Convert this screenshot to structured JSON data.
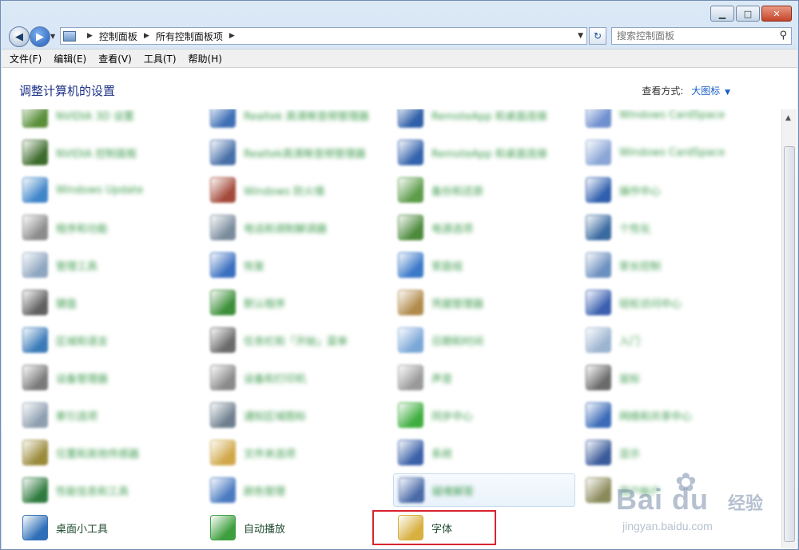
{
  "window": {
    "address_path": [
      "控制面板",
      "所有控制面板项"
    ],
    "search_placeholder": "搜索控制面板",
    "caption_buttons": {
      "minimize": "▁",
      "maximize": "□",
      "close": "✕"
    }
  },
  "menu": [
    "文件(F)",
    "编辑(E)",
    "查看(V)",
    "工具(T)",
    "帮助(H)"
  ],
  "page": {
    "title": "调整计算机的设置",
    "view_by_label": "查看方式:",
    "view_by_value": "大图标"
  },
  "items": [
    {
      "label": "NVIDIA 3D 设置",
      "color": "#5a8f3a",
      "blurred": true
    },
    {
      "label": "Realtek 高清晰音频管理器",
      "color": "#3f6fb5",
      "blurred": true
    },
    {
      "label": "RemoteApp 和桌面连接",
      "color": "#2e5fa8",
      "blurred": true
    },
    {
      "label": "Windows CardSpace",
      "color": "#6f8fcf",
      "blurred": true
    },
    {
      "label": "NVIDIA 控制面板",
      "color": "#3d6b2b",
      "blurred": true
    },
    {
      "label": "Realtek高清晰音频管理器",
      "color": "#476fa8",
      "blurred": true
    },
    {
      "label": "RemoteApp 和桌面连接",
      "color": "#3262ac",
      "blurred": true
    },
    {
      "label": "Windows CardSpace",
      "color": "#8aa5d6",
      "blurred": true
    },
    {
      "label": "Windows Update",
      "color": "#3f85c9",
      "blurred": true
    },
    {
      "label": "Windows 防火墙",
      "color": "#a44a3a",
      "blurred": true
    },
    {
      "label": "备份和还原",
      "color": "#5c9c4a",
      "blurred": true
    },
    {
      "label": "操作中心",
      "color": "#2f5fae",
      "blurred": true
    },
    {
      "label": "程序和功能",
      "color": "#8c8c8c",
      "blurred": true
    },
    {
      "label": "电话和调制解调器",
      "color": "#7a8c9c",
      "blurred": true
    },
    {
      "label": "电源选项",
      "color": "#4d8a3c",
      "blurred": true
    },
    {
      "label": "个性化",
      "color": "#3a6aa0",
      "blurred": true
    },
    {
      "label": "管理工具",
      "color": "#8fa6c0",
      "blurred": true
    },
    {
      "label": "恢复",
      "color": "#3a6fc0",
      "blurred": true
    },
    {
      "label": "家庭组",
      "color": "#3a78c8",
      "blurred": true
    },
    {
      "label": "家长控制",
      "color": "#6b8fc0",
      "blurred": true
    },
    {
      "label": "键盘",
      "color": "#606060",
      "blurred": true
    },
    {
      "label": "默认程序",
      "color": "#3d8f3a",
      "blurred": true
    },
    {
      "label": "凭据管理器",
      "color": "#b08a4a",
      "blurred": true
    },
    {
      "label": "轻松访问中心",
      "color": "#3a5fb0",
      "blurred": true
    },
    {
      "label": "区域和语言",
      "color": "#3a7ab8",
      "blurred": true
    },
    {
      "label": "任务栏和「开始」菜单",
      "color": "#6a6a6a",
      "blurred": true
    },
    {
      "label": "日期和时间",
      "color": "#7ba7d8",
      "blurred": true
    },
    {
      "label": "入门",
      "color": "#9cb4d0",
      "blurred": true
    },
    {
      "label": "设备管理器",
      "color": "#7a7a7a",
      "blurred": true
    },
    {
      "label": "设备和打印机",
      "color": "#8a8a8a",
      "blurred": true
    },
    {
      "label": "声音",
      "color": "#9a9a9a",
      "blurred": true
    },
    {
      "label": "鼠标",
      "color": "#6a6a6a",
      "blurred": true
    },
    {
      "label": "索引选项",
      "color": "#8f9fb0",
      "blurred": true
    },
    {
      "label": "通知区域图标",
      "color": "#6f7f8f",
      "blurred": true
    },
    {
      "label": "同步中心",
      "color": "#3fae3f",
      "blurred": true
    },
    {
      "label": "网络和共享中心",
      "color": "#3a6ab8",
      "blurred": true
    },
    {
      "label": "位置和其他传感器",
      "color": "#9a8a3a",
      "blurred": true
    },
    {
      "label": "文件夹选项",
      "color": "#d0a84a",
      "blurred": true
    },
    {
      "label": "系统",
      "color": "#3a60a8",
      "blurred": true
    },
    {
      "label": "显示",
      "color": "#3a5a9a",
      "blurred": true
    },
    {
      "label": "性能信息和工具",
      "color": "#2f7a3f",
      "blurred": true
    },
    {
      "label": "颜色管理",
      "color": "#4a7ac0",
      "blurred": true
    },
    {
      "label": "疑难解答",
      "color": "#4a6aa8",
      "blurred": true
    },
    {
      "label": "用户帐户",
      "color": "#8a8a5a",
      "blurred": true
    },
    {
      "label": "桌面小工具",
      "color": "#2f6fb8",
      "blurred": false
    },
    {
      "label": "自动播放",
      "color": "#3f9f3f",
      "blurred": false
    },
    {
      "label": "字体",
      "color": "#d8b040",
      "blurred": false
    }
  ],
  "watermark": {
    "brand": "Bai du",
    "tag": "经验",
    "url": "jingyan.baidu.com"
  }
}
